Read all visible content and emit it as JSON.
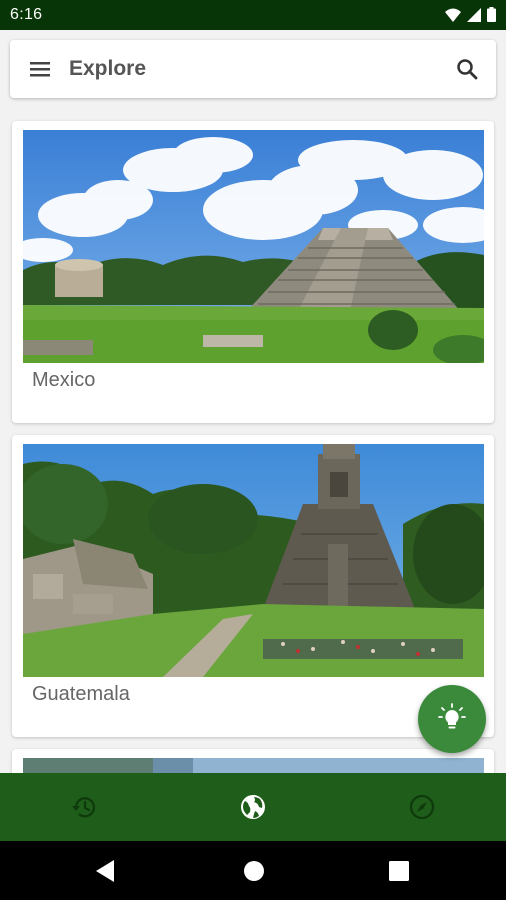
{
  "status_bar": {
    "time": "6:16"
  },
  "app_bar": {
    "title": "Explore",
    "menu_icon": "menu-icon",
    "search_icon": "search-icon"
  },
  "cards": [
    {
      "label": "Mexico",
      "image": "pyramid-photo"
    },
    {
      "label": "Guatemala",
      "image": "temple-photo"
    },
    {
      "label": "",
      "image": "landscape-photo"
    }
  ],
  "fab": {
    "icon": "lightbulb-icon",
    "color": "#3b8a3b"
  },
  "bottom_nav": {
    "color": "#1f5e1a",
    "items": [
      {
        "icon": "history-icon",
        "active": false
      },
      {
        "icon": "globe-icon",
        "active": true
      },
      {
        "icon": "compass-icon",
        "active": false
      }
    ]
  },
  "colors": {
    "status_bar": "#073507",
    "background": "#f2f2f2"
  }
}
